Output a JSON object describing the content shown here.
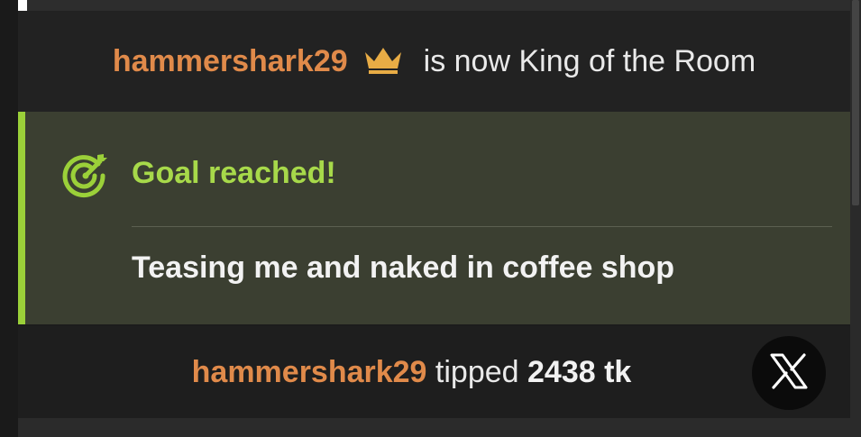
{
  "king_notice": {
    "username": "hammershark29",
    "message": "is now King of the Room",
    "crown_icon": "crown-icon"
  },
  "goal": {
    "icon": "target-arrow-icon",
    "title": "Goal reached!",
    "description": "Teasing me and naked in coffee shop",
    "accent_color": "#9bd039"
  },
  "tip": {
    "username": "hammershark29",
    "verb": "tipped",
    "amount": "2438 tk"
  },
  "x_button": {
    "icon": "x-logo-icon"
  },
  "colors": {
    "username": "#e08a4a",
    "goal_title": "#a7d94a",
    "goal_background": "#3b3f31"
  }
}
